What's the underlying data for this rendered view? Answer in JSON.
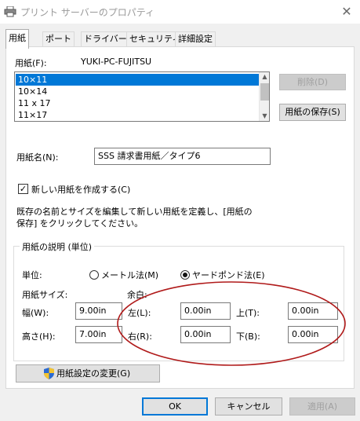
{
  "window": {
    "title": "プリント サーバーのプロパティ",
    "close_glyph": "✕"
  },
  "tabs": [
    {
      "label": "用紙",
      "active": true
    },
    {
      "label": "ポート",
      "active": false
    },
    {
      "label": "ドライバー",
      "active": false
    },
    {
      "label": "セキュリティ",
      "active": false
    },
    {
      "label": "詳細設定",
      "active": false
    }
  ],
  "paper": {
    "label": "用紙(F):",
    "server_name": "YUKI-PC-FUJITSU",
    "list": [
      "10×11",
      "10×14",
      "11 x 17",
      "11×17"
    ],
    "selected_index": 0,
    "delete_button": "削除(D)",
    "save_button": "用紙の保存(S)"
  },
  "form_name": {
    "label": "用紙名(N):",
    "value": "SSS 請求書用紙／タイプ6"
  },
  "create_new": {
    "label": "新しい用紙を作成する(C)",
    "checked": true
  },
  "description_text": {
    "line1": "既存の名前とサイズを編集して新しい用紙を定義し、[用紙の",
    "line2": "保存] をクリックしてください。"
  },
  "group": {
    "title": "用紙の説明 (単位)",
    "unit_label": "単位:",
    "metric_label": "メートル法(M)",
    "imperial_label": "ヤードポンド法(E)",
    "imperial_selected": true,
    "paper_size_label": "用紙サイズ:",
    "margin_label": "余白:",
    "width_label": "幅(W):",
    "width_value": "9.00in",
    "height_label": "高さ(H):",
    "height_value": "7.00in",
    "left_label": "左(L):",
    "left_value": "0.00in",
    "right_label": "右(R):",
    "right_value": "0.00in",
    "top_label": "上(T):",
    "top_value": "0.00in",
    "bottom_label": "下(B):",
    "bottom_value": "0.00in"
  },
  "change_settings_button": "用紙設定の変更(G)",
  "footer": {
    "ok": "OK",
    "cancel": "キャンセル",
    "apply": "適用(A)"
  },
  "colors": {
    "selection": "#0078d7",
    "annotation": "#b01a1a",
    "shield_blue": "#2a6ad2",
    "shield_yellow": "#f4c430"
  }
}
